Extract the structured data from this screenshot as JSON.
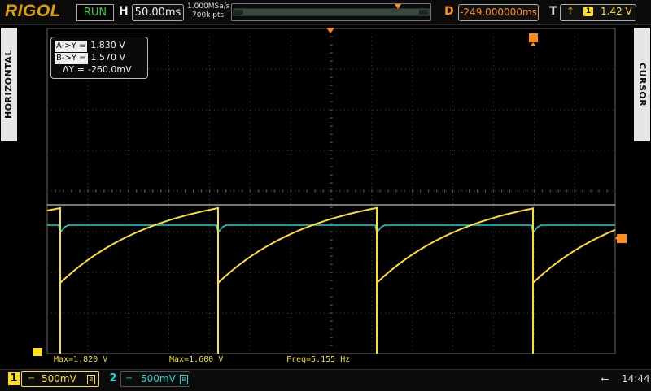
{
  "header": {
    "brand": "RIGOL",
    "run_state": "RUN",
    "horizontal_label": "H",
    "timebase": "50.00ms",
    "sample_rate": "1.000MSa/s",
    "memory_depth": "700k pts",
    "delay_label": "D",
    "delay": "-249.000000ms",
    "trigger_label": "T",
    "trigger_edge": "rising",
    "trigger_source": "1",
    "trigger_level": "1.42 V"
  },
  "side_tabs": {
    "left": "HORIZONTAL",
    "right": "CURSOR"
  },
  "cursor": {
    "a_label": "A->Y =",
    "a_value": "1.830 V",
    "b_label": "B->Y =",
    "b_value": "1.570 V",
    "delta_label": "ΔY =",
    "delta_value": "-260.0mV"
  },
  "measurements": {
    "ch1_max": "Max=1.820 V",
    "ch2_max": "Max=1.600 V",
    "freq": "Freq=5.155 Hz"
  },
  "channels": [
    {
      "number": "1",
      "coupling": "DC",
      "scale": "500mV",
      "color": "#ffe020"
    },
    {
      "number": "2",
      "coupling": "DC",
      "scale": "500mV",
      "color": "#19d5d5"
    }
  ],
  "status": {
    "usb": "usb-icon",
    "time": "14:44"
  },
  "colors": {
    "ch1": "#ffe020",
    "ch2": "#19d5d5",
    "delay": "#ff8c1a",
    "run": "#2fd52f",
    "grid": "#555555"
  }
}
